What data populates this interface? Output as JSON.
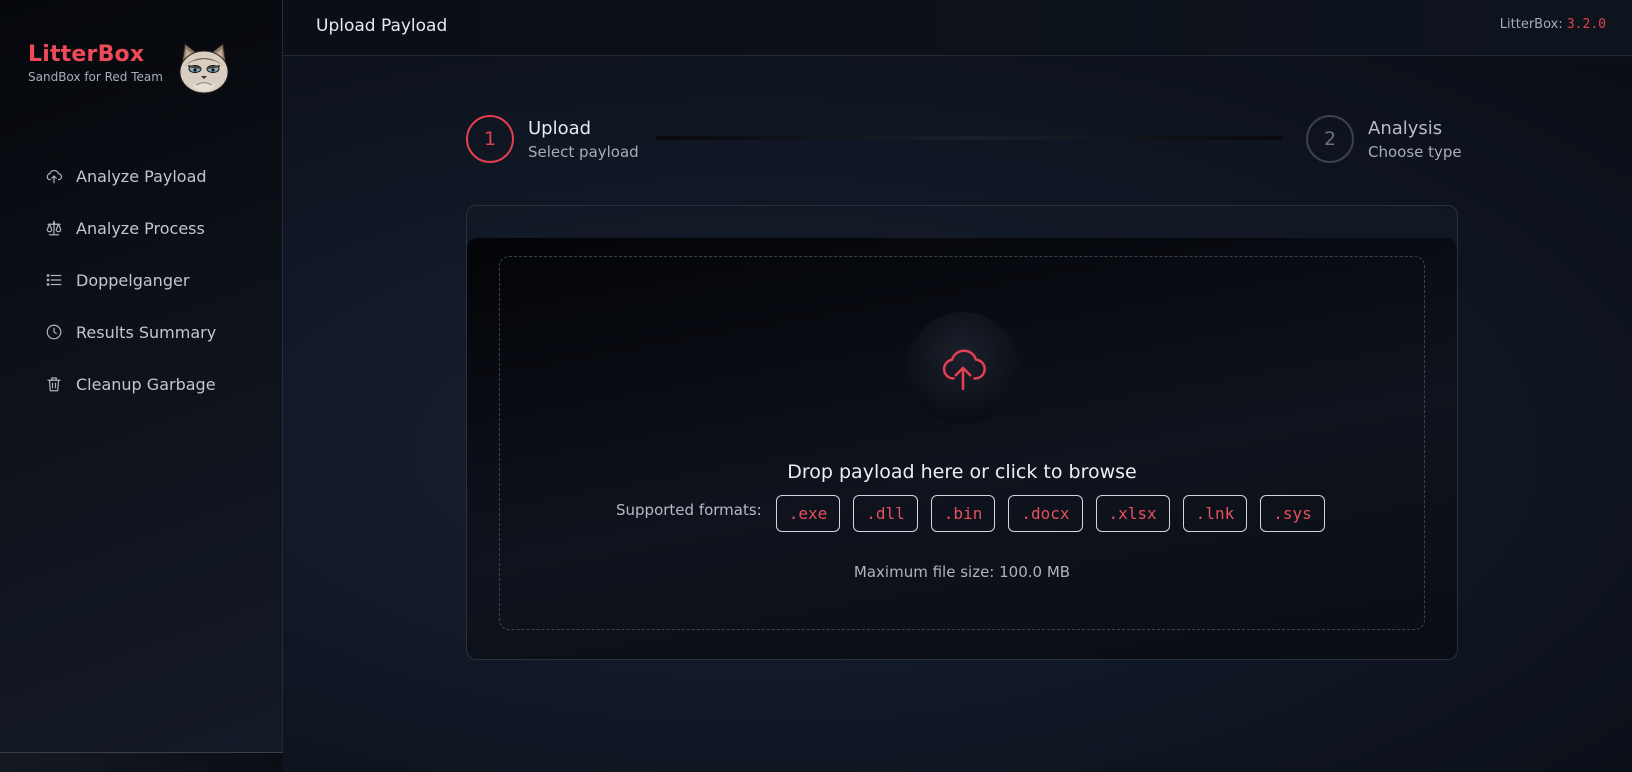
{
  "sidebar": {
    "brand_name": "LitterBox",
    "brand_subtitle": "SandBox for Red Team",
    "logo_icon": "grumpy-cat-logo",
    "items": [
      {
        "label": "Analyze Payload",
        "icon": "cloud-upload-icon"
      },
      {
        "label": "Analyze Process",
        "icon": "scale-icon"
      },
      {
        "label": "Doppelganger",
        "icon": "list-icon"
      },
      {
        "label": "Results Summary",
        "icon": "clock-icon"
      },
      {
        "label": "Cleanup Garbage",
        "icon": "trash-icon"
      }
    ]
  },
  "header": {
    "title": "Upload Payload",
    "version_label": "LitterBox:",
    "version": "3.2.0"
  },
  "stepper": {
    "steps": [
      {
        "number": "1",
        "title": "Upload",
        "subtitle": "Select payload",
        "active": true
      },
      {
        "number": "2",
        "title": "Analysis",
        "subtitle": "Choose type",
        "active": false
      }
    ]
  },
  "upload": {
    "icon": "cloud-upload-icon",
    "drop_text": "Drop payload here or click to browse",
    "formats_label": "Supported formats:",
    "formats": [
      ".exe",
      ".dll",
      ".bin",
      ".docx",
      ".xlsx",
      ".lnk",
      ".sys"
    ],
    "max_size": "Maximum file size: 100.0 MB"
  },
  "colors": {
    "accent": "#e0404e",
    "background": "#0d121b",
    "text": "#e2e5ea"
  }
}
